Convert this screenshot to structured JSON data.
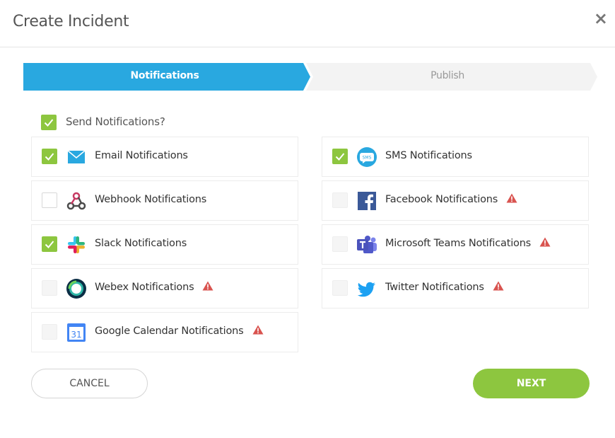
{
  "dialog": {
    "title": "Create Incident",
    "close_glyph": "×"
  },
  "stepper": {
    "steps": [
      {
        "label": "Notifications",
        "active": true
      },
      {
        "label": "Publish",
        "active": false
      }
    ],
    "active_color": "#29a8e0",
    "inactive_color": "#f3f3f3"
  },
  "send_notifications": {
    "label": "Send Notifications?",
    "checked": true
  },
  "channels": {
    "email": {
      "label": "Email Notifications",
      "icon": "email-icon",
      "checked": true,
      "warning": false
    },
    "webhook": {
      "label": "Webhook Notifications",
      "icon": "webhook-icon",
      "checked": false,
      "warning": false
    },
    "slack": {
      "label": "Slack Notifications",
      "icon": "slack-icon",
      "checked": true,
      "warning": false
    },
    "webex": {
      "label": "Webex Notifications",
      "icon": "webex-icon",
      "checked": false,
      "disabled": true,
      "warning": true
    },
    "google_calendar": {
      "label": "Google Calendar Notifications",
      "icon": "google-calendar-icon",
      "icon_text": "31",
      "checked": false,
      "disabled": true,
      "warning": true
    },
    "sms": {
      "label": "SMS Notifications",
      "icon": "sms-icon",
      "icon_text": "SMS",
      "checked": true,
      "warning": false
    },
    "facebook": {
      "label": "Facebook Notifications",
      "icon": "facebook-icon",
      "checked": false,
      "disabled": true,
      "warning": true
    },
    "teams": {
      "label": "Microsoft Teams Notifications",
      "icon": "microsoft-teams-icon",
      "checked": false,
      "disabled": true,
      "warning": true
    },
    "twitter": {
      "label": "Twitter Notifications",
      "icon": "twitter-icon",
      "checked": false,
      "disabled": true,
      "warning": true
    }
  },
  "footer": {
    "cancel_label": "CANCEL",
    "next_label": "NEXT"
  },
  "colors": {
    "accent_green": "#8dc63f",
    "accent_blue": "#29a8e0",
    "warning_red": "#d9534f"
  }
}
